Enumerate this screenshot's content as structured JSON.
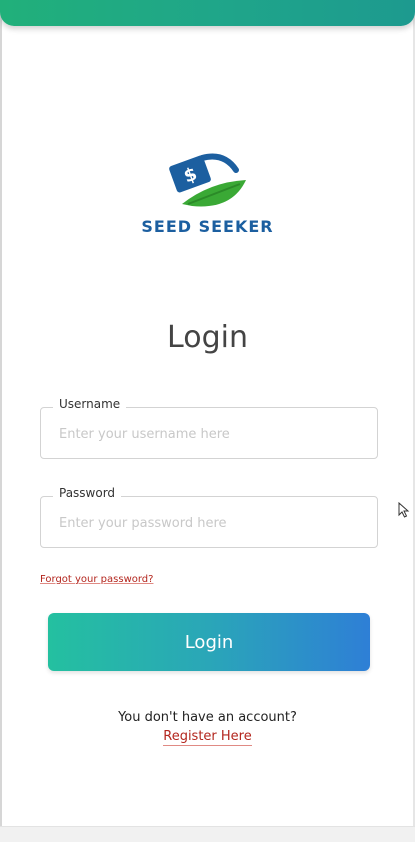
{
  "app": {
    "brand_name": "SEED SEEKER",
    "accent_colors": {
      "header": "#21b07a",
      "button_start": "#24c0a0",
      "button_end": "#2e7fd6",
      "brand_text": "#1c5fa0",
      "link": "#b3261e"
    }
  },
  "icons": {
    "logo": "money-leaf-logo",
    "cursor": "mouse-pointer-icon"
  },
  "page": {
    "title": "Login"
  },
  "form": {
    "username": {
      "label": "Username",
      "placeholder": "Enter your username here",
      "value": ""
    },
    "password": {
      "label": "Password",
      "placeholder": "Enter your password here",
      "value": ""
    },
    "forgot_password": "Forgot your password?",
    "submit_label": "Login"
  },
  "footer": {
    "prompt": "You don't have an account?",
    "register_link": "Register Here"
  }
}
